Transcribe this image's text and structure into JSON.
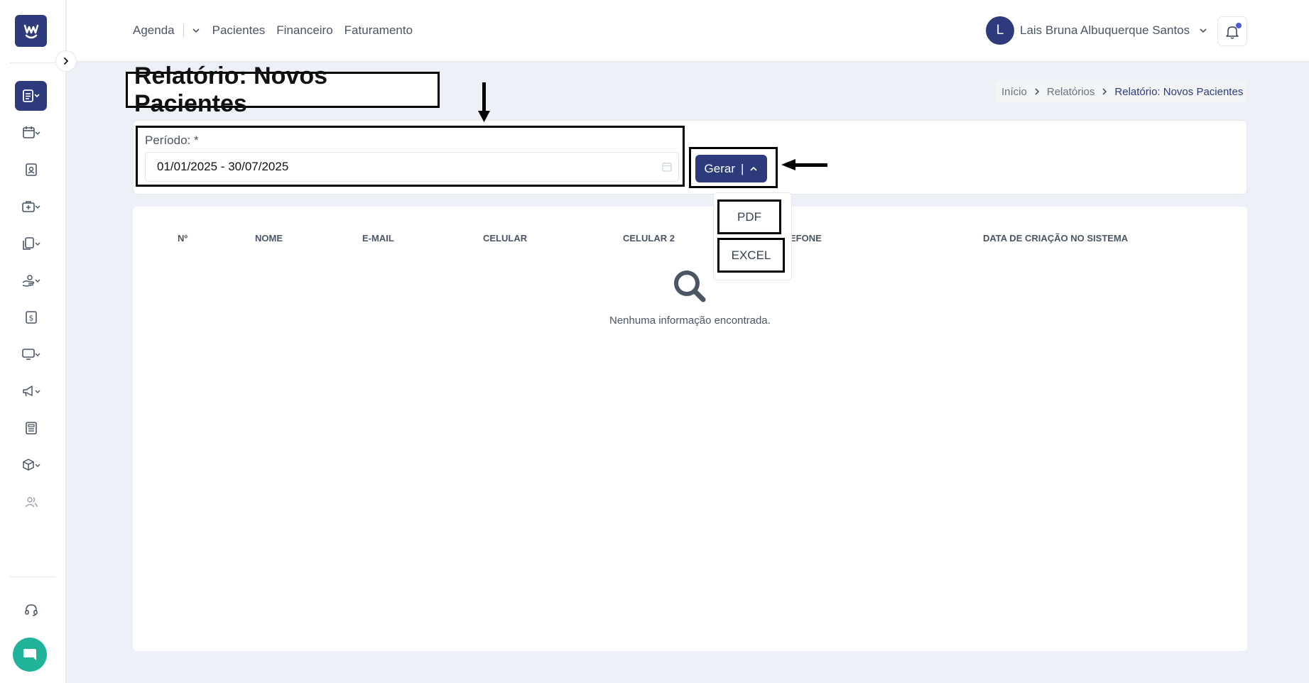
{
  "topbar": {
    "nav": [
      {
        "label": "Agenda"
      },
      {
        "label": "Pacientes"
      },
      {
        "label": "Financeiro"
      },
      {
        "label": "Faturamento"
      }
    ],
    "user": {
      "initial": "L",
      "name": "Lais Bruna Albuquerque Santos"
    }
  },
  "page": {
    "title": "Relatório: Novos Pacientes",
    "breadcrumb": [
      "Início",
      "Relatórios",
      "Relatório: Novos Pacientes"
    ]
  },
  "filter": {
    "period_label": "Período: *",
    "period_value": "01/01/2025 - 30/07/2025",
    "generate_label": "Gerar",
    "generate_separator": "|"
  },
  "dropdown": {
    "options": [
      "PDF",
      "EXCEL"
    ]
  },
  "table": {
    "headers": [
      "Nº",
      "NOME",
      "E-MAIL",
      "CELULAR",
      "CELULAR 2",
      "EFONE",
      "DATA DE CRIAÇÃO NO SISTEMA"
    ],
    "empty_message": "Nenhuma informação encontrada."
  },
  "colors": {
    "primary": "#2d3a7c",
    "chat": "#21b39a",
    "notification_dot": "#4f5bd5"
  },
  "icons": {
    "sidebar": [
      "reports-icon",
      "calendar-icon",
      "patient-badge-icon",
      "medical-bag-icon",
      "documents-icon",
      "hand-money-icon",
      "dollar-icon",
      "monitor-icon",
      "megaphone-icon",
      "newspaper-icon",
      "box-icon",
      "users-icon",
      "headset-icon",
      "chat-icon"
    ]
  }
}
